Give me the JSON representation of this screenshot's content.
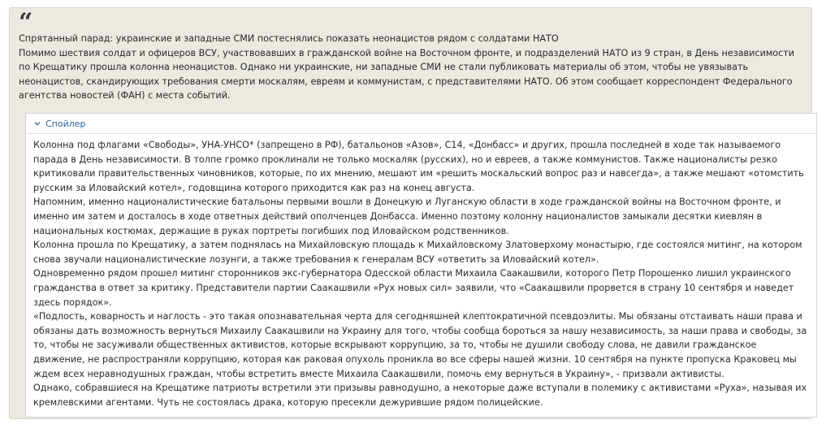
{
  "quote": {
    "mark": "“",
    "title": "Спрятанный парад: украинские и западные СМИ постеснялись показать неонацистов рядом с солдатами НАТО",
    "lead": "Помимо шествия солдат и офицеров ВСУ, участвовавших в гражданской войне на Восточном фронте, и подразделений НАТО из 9 стран, в День независимости по Крещатику прошла колонна неонацистов. Однако ни украинские, ни западные СМИ не стали публиковать материалы об этом, чтобы не увязывать неонацистов, скандирующих требования смерти москалям, евреям и коммунистам, с представителями НАТО. Об этом сообщает корреспондент Федерального агентства новостей (ФАН) с места событий."
  },
  "spoiler": {
    "label": "Спойлер",
    "icon": "chevron-down-icon",
    "paragraphs": [
      "Колонна под флагами «Свободы», УНА-УНСО* (запрещено в РФ), батальонов «Азов», С14, «Донбасс» и других, прошла последней в ходе так называемого парада в День независимости. В толпе громко проклинали не только москаляк (русских), но и евреев, а также коммунистов. Также националисты резко критиковали правительственных чиновников, которые, по их мнению, мешают им «решить москальский вопрос раз и навсегда», а также мешают «отомстить русским за Иловайский котел», годовщина которого приходится как раз на конец августа.",
      "Напомним, именно националистические батальоны первыми вошли в Донецкую и Луганскую области в ходе гражданской войны на Восточном фронте, и именно им затем и досталось в ходе ответных действий ополченцев Донбасса. Именно поэтому колонну националистов замыкали десятки киевлян в национальных костюмах, держащие в руках портреты погибших под Иловайском родственников.",
      "Колонна прошла по Крещатику, а затем поднялась на Михайловскую площадь к Михайловскому Златоверхому монастырю, где состоялся митинг, на котором снова звучали националистические лозунги, а также требования к генералам ВСУ «ответить за Иловайский котел».",
      "Одновременно рядом прошел митинг сторонников экс-губернатора Одесской области Михаила Саакашвили, которого Петр Порошенко лишил украинского гражданства в ответ за критику. Представители партии Саакашвили «Рух новых сил» заявили, что «Саакашвили прорвется в страну 10 сентября и наведет здесь порядок».",
      "«Подлость, коварность и наглость - это такая опознавательная черта для сегодняшней клептократичной псевдоэлиты. Мы обязаны отстаивать наши права и обязаны дать возможность вернуться Михаилу Саакашвили на Украину для того, чтобы сообща бороться за нашу независимость, за наши права и свободы, за то, чтобы не засуживали общественных активистов, которые вскрывают коррупцию, за то, чтобы не душили свободу слова, не давили гражданское движение, не распространяли коррупцию, которая как раковая опухоль проникла во все сферы нашей жизни. 10 сентября на пункте пропуска Краковец мы ждем всех неравнодушных граждан, чтобы встретить вместе Михаила Саакашвили, помочь ему вернуться в Украину», - призвали активисты.",
      "Однако, собравшиеся на Крещатике патриоты встретили эти призывы равнодушно, а некоторые даже вступали в полемику с активистами «Руха», называя их кремлевскими агентами. Чуть не состоялась драка, которую пресекли дежурившие рядом полицейские."
    ]
  },
  "colors": {
    "quote_background": "#ebe9e1",
    "spoiler_link": "#2a6496"
  }
}
